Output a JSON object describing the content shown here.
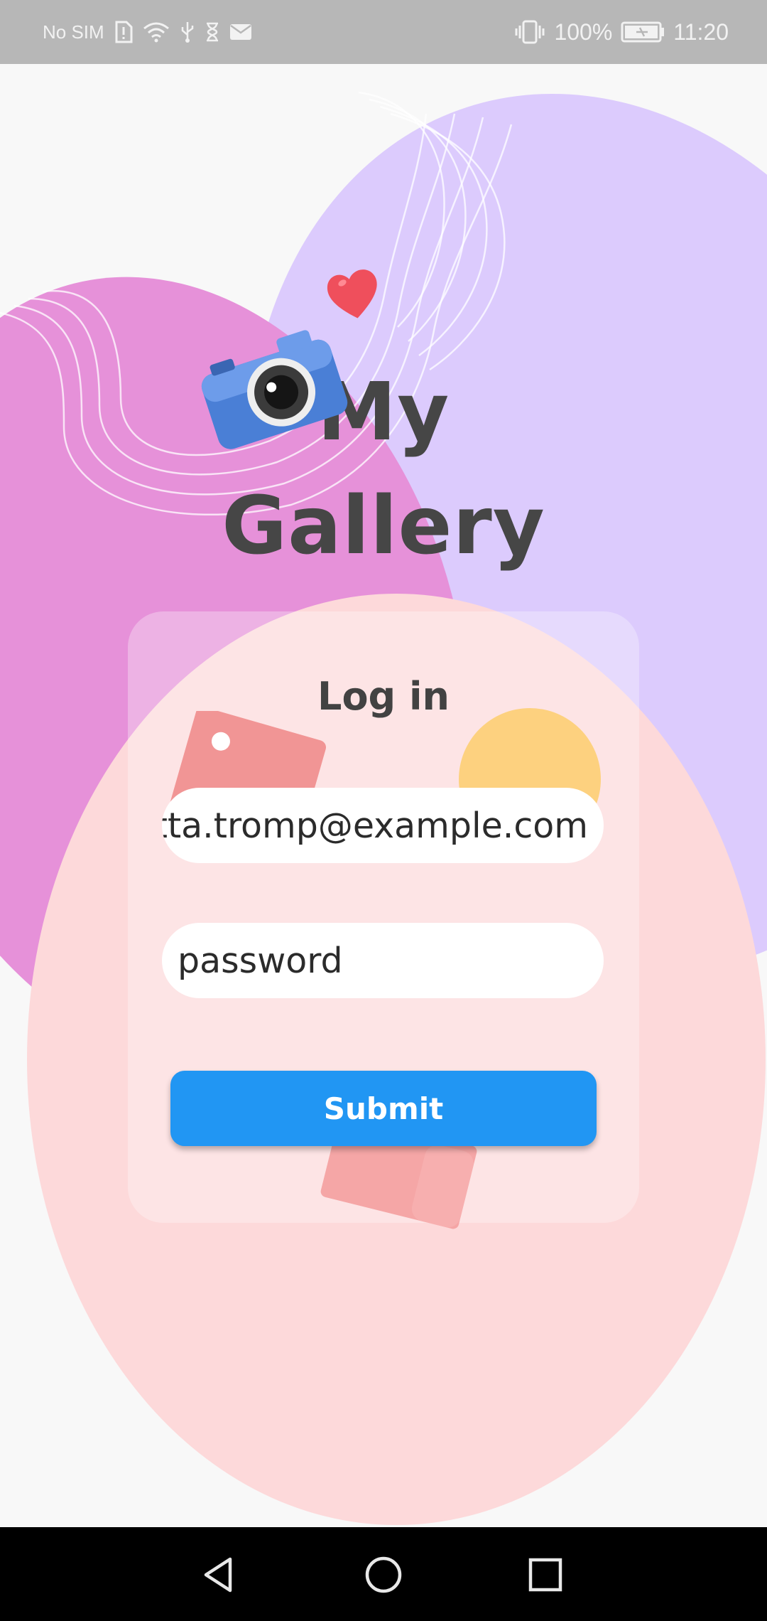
{
  "status_bar": {
    "carrier": "No SIM",
    "battery": "100%",
    "time": "11:20",
    "icons": [
      "sim-alert-icon",
      "wifi-icon",
      "usb-icon",
      "hourglass-icon",
      "mail-icon",
      "vibrate-icon",
      "battery-charging-icon"
    ]
  },
  "header": {
    "title_line1": "My",
    "title_line2": "Gallery",
    "icons": [
      "camera-icon",
      "heart-icon"
    ]
  },
  "login": {
    "title": "Log in",
    "email_value": "loretta.tromp@example.com",
    "password_placeholder": "password",
    "submit_label": "Submit"
  },
  "nav_bar": {
    "buttons": [
      "back-icon",
      "home-icon",
      "recents-icon"
    ]
  },
  "colors": {
    "accent": "#2196f3",
    "blob_purple": "#dccbfd",
    "blob_magenta": "#e691d9",
    "blob_pink": "#fdd9da",
    "title_text": "#464646"
  }
}
